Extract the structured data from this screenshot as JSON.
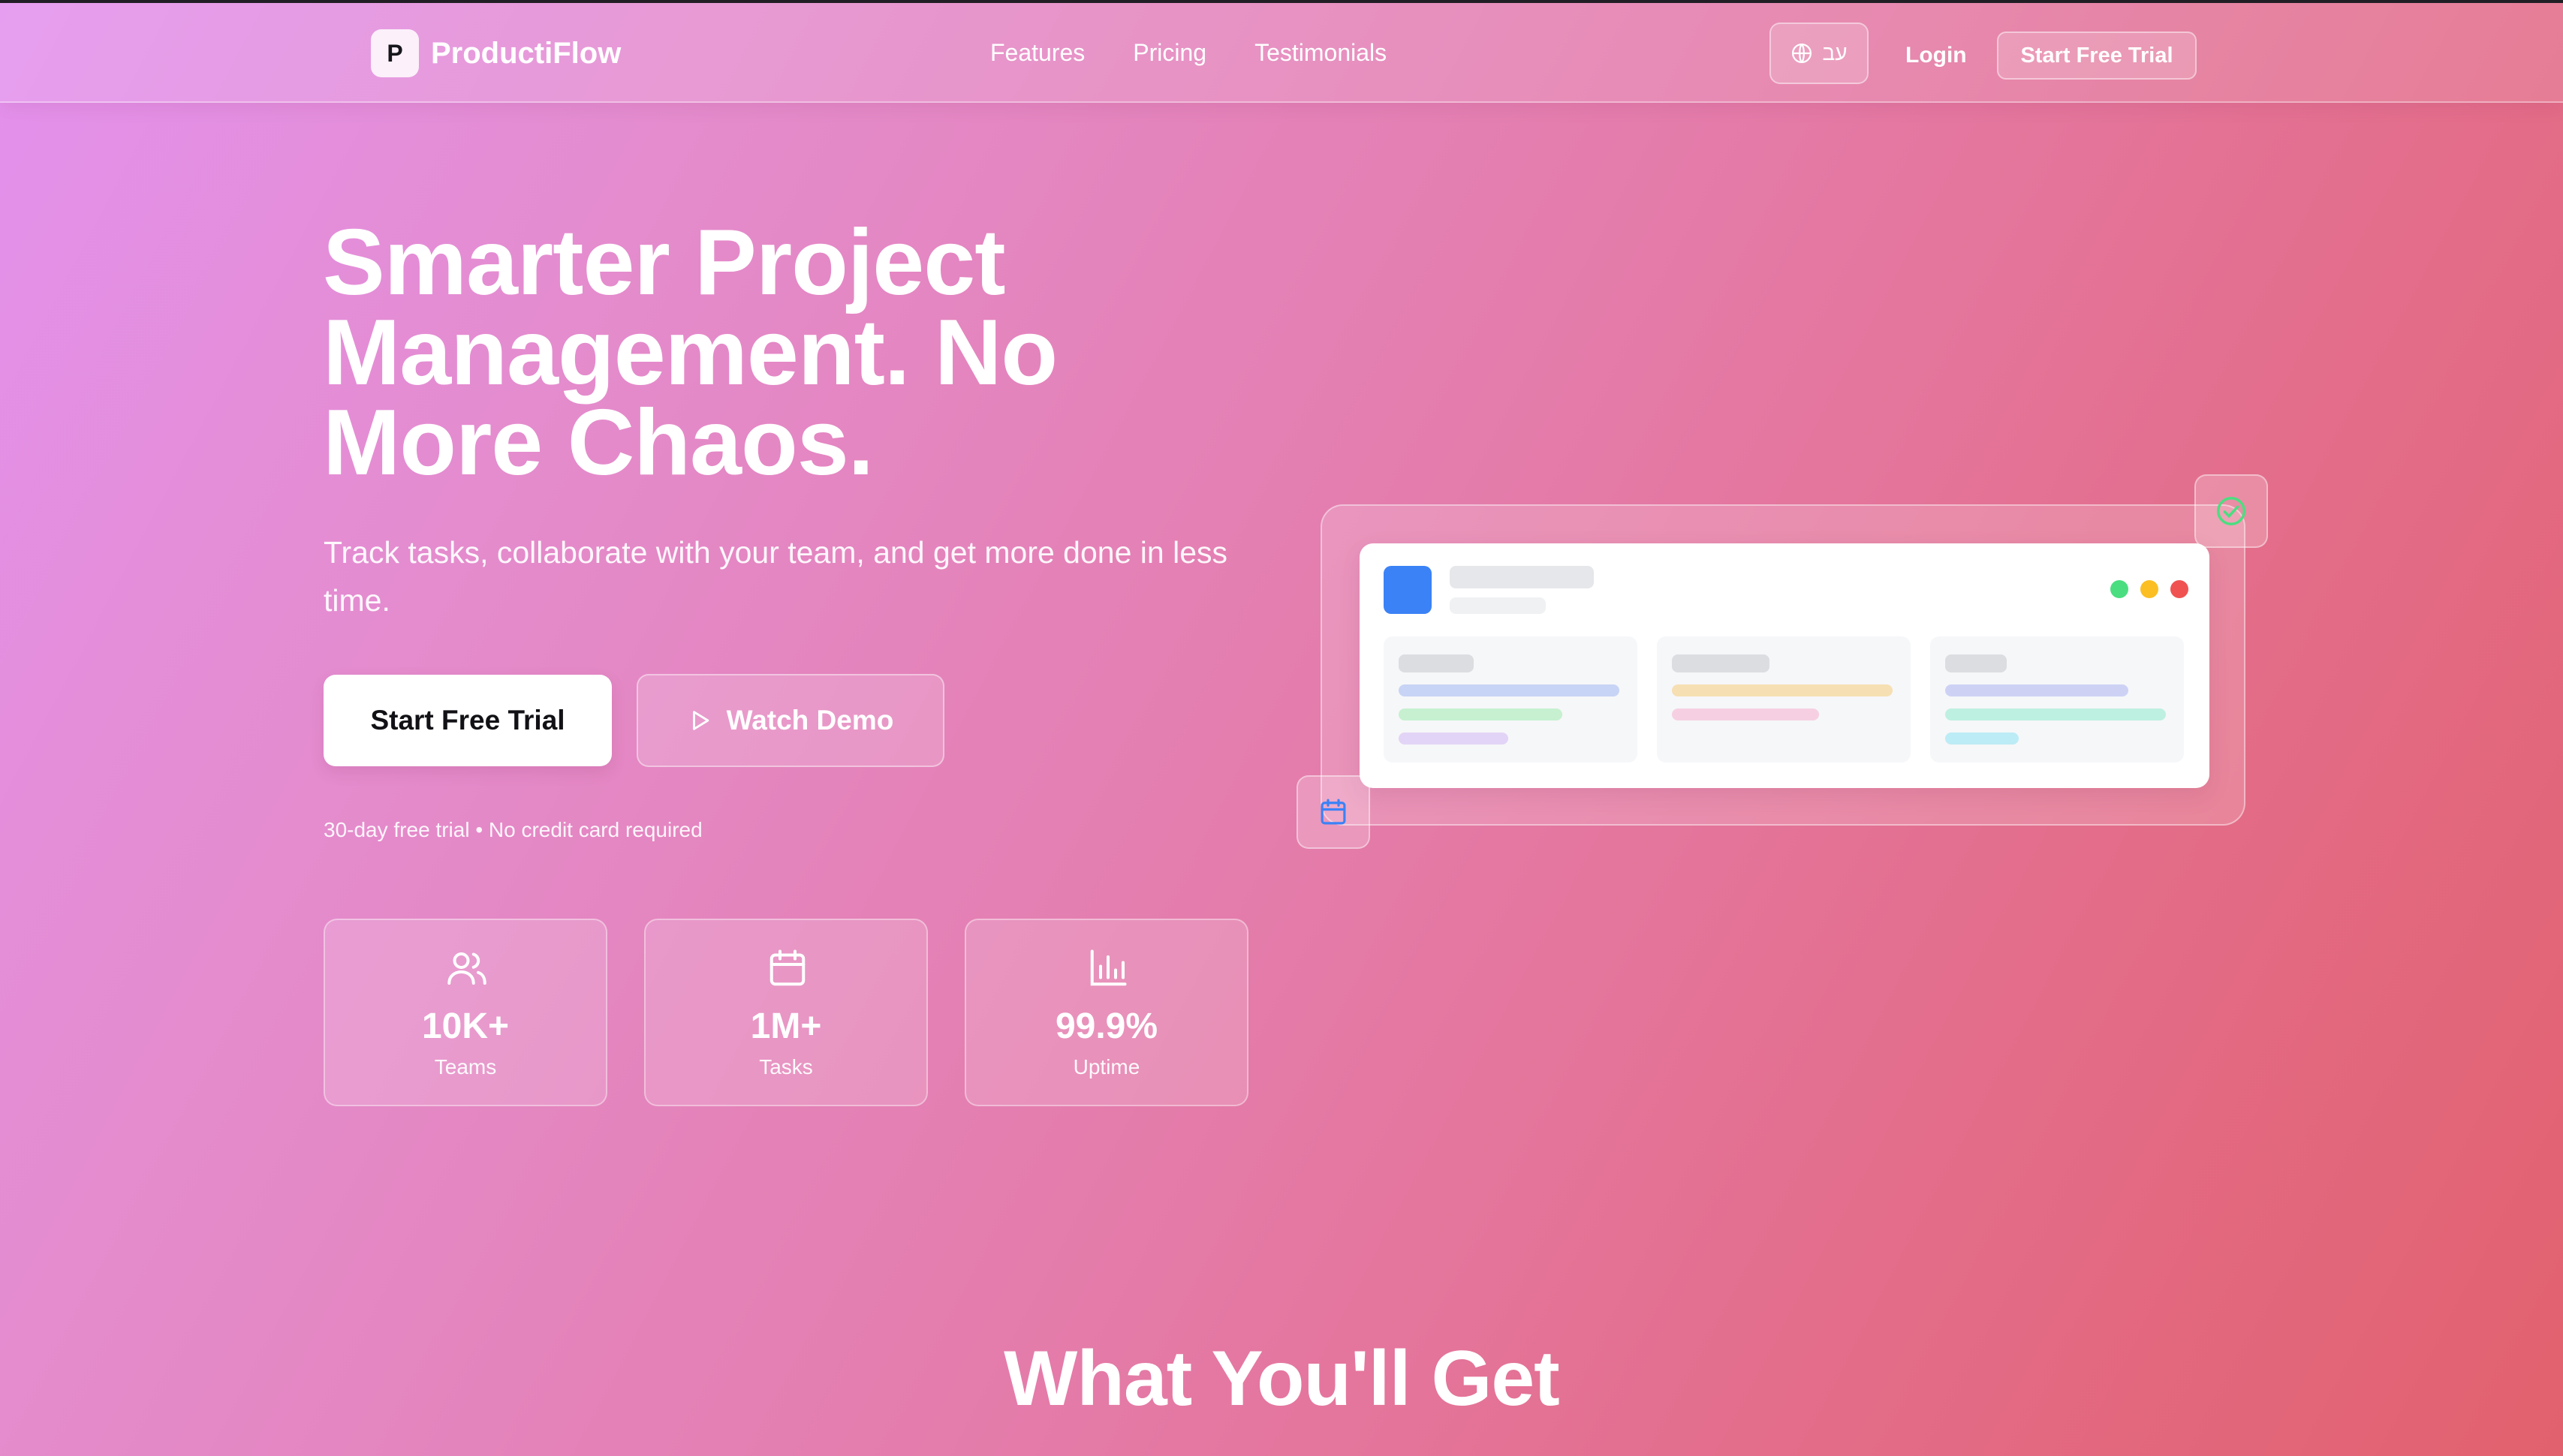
{
  "header": {
    "logo_letter": "P",
    "brand": "ProductiFlow",
    "nav": [
      "Features",
      "Pricing",
      "Testimonials"
    ],
    "language_label": "עב",
    "login": "Login",
    "cta": "Start Free Trial"
  },
  "hero": {
    "title": "Smarter Project Management. No More Chaos.",
    "subtitle": "Track tasks, collaborate with your team, and get more done in less time.",
    "primary_button": "Start Free Trial",
    "secondary_button": "Watch Demo",
    "note": "30-day free trial • No credit card required"
  },
  "stats": [
    {
      "icon": "users-icon",
      "value": "10K+",
      "label": "Teams"
    },
    {
      "icon": "calendar-icon",
      "value": "1M+",
      "label": "Tasks"
    },
    {
      "icon": "bar-chart-icon",
      "value": "99.9%",
      "label": "Uptime"
    }
  ],
  "mockup": {
    "window_dot_colors": [
      "#4ade80",
      "#fbbf24",
      "#f05252"
    ],
    "accent": "#3b82f6"
  },
  "section": {
    "title": "What You'll Get"
  }
}
